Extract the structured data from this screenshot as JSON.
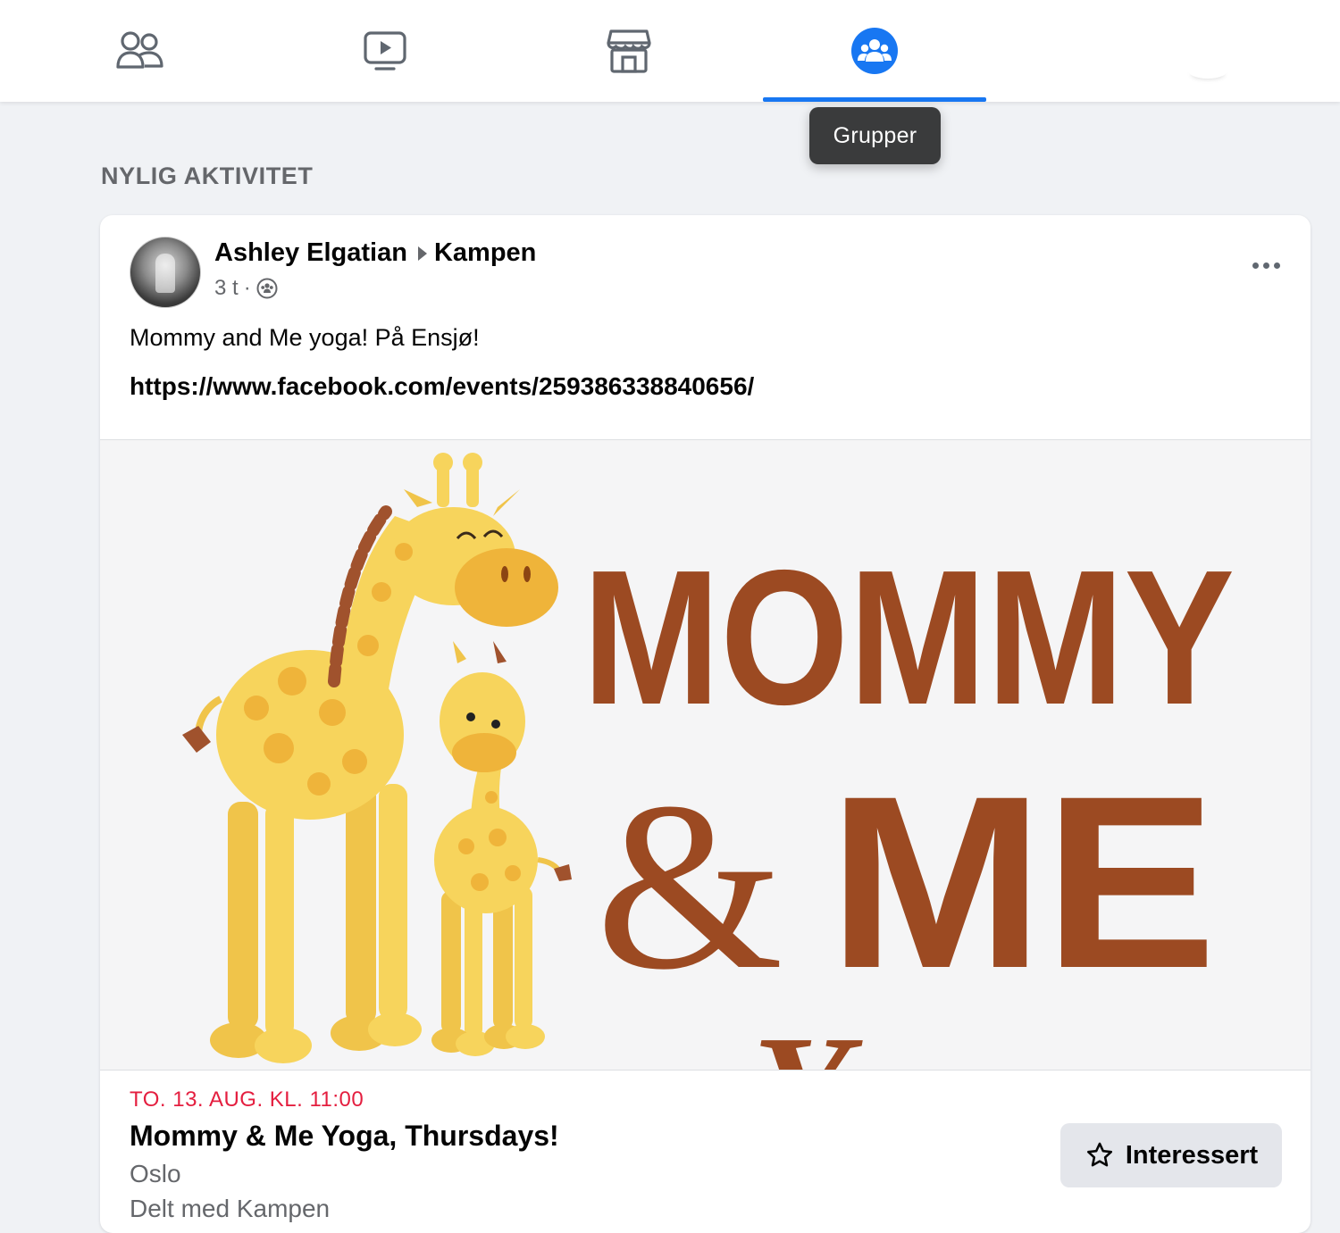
{
  "nav": {
    "tabs": [
      {
        "name": "friends",
        "icon": "friends-icon"
      },
      {
        "name": "watch",
        "icon": "watch-video-icon"
      },
      {
        "name": "marketplace",
        "icon": "marketplace-store-icon"
      },
      {
        "name": "groups",
        "icon": "groups-icon",
        "active": true
      }
    ],
    "active_color": "#1877f2"
  },
  "tooltip": {
    "text": "Grupper"
  },
  "section": {
    "title": "NYLIG AKTIVITET"
  },
  "post": {
    "author": "Ashley Elgatian",
    "group": "Kampen",
    "time": "3 t",
    "separator": "·",
    "audience_icon": "group-audience-icon",
    "text": "Mommy and Me yoga! På Ensjø!",
    "link": "https://www.facebook.com/events/259386338840656/",
    "more_icon": "more-options-icon",
    "image": {
      "line1": "MOMMY",
      "ampersand": "&",
      "line2": "ME",
      "line3": "Yoga"
    }
  },
  "event": {
    "date": "TO. 13. AUG. KL. 11:00",
    "title": "Mommy & Me Yoga, Thursdays!",
    "location": "Oslo",
    "shared": "Delt med Kampen",
    "button_label": "Interessert",
    "date_color": "#e41e3f"
  }
}
